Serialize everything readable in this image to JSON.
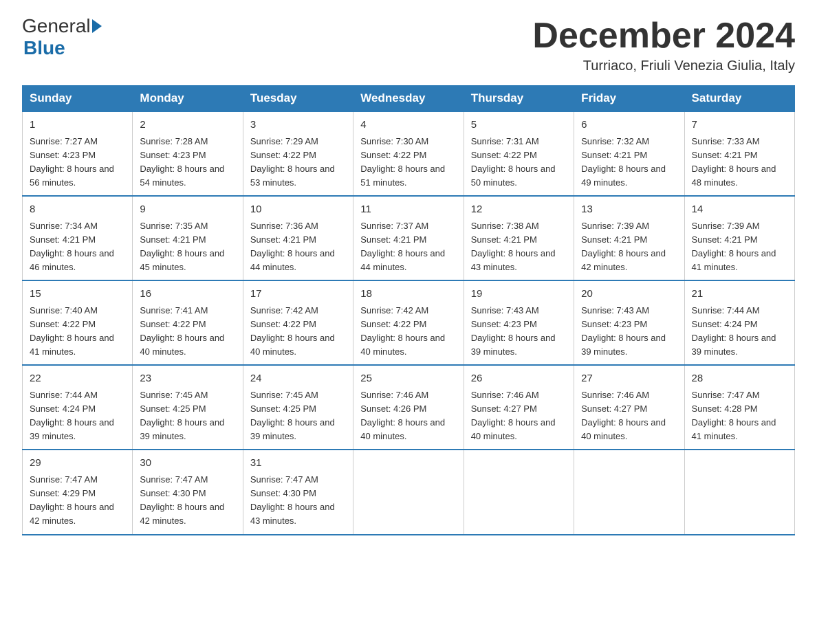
{
  "logo": {
    "general": "General",
    "blue": "Blue"
  },
  "header": {
    "title": "December 2024",
    "location": "Turriaco, Friuli Venezia Giulia, Italy"
  },
  "weekdays": [
    "Sunday",
    "Monday",
    "Tuesday",
    "Wednesday",
    "Thursday",
    "Friday",
    "Saturday"
  ],
  "weeks": [
    [
      {
        "day": "1",
        "sunrise": "7:27 AM",
        "sunset": "4:23 PM",
        "daylight": "8 hours and 56 minutes."
      },
      {
        "day": "2",
        "sunrise": "7:28 AM",
        "sunset": "4:23 PM",
        "daylight": "8 hours and 54 minutes."
      },
      {
        "day": "3",
        "sunrise": "7:29 AM",
        "sunset": "4:22 PM",
        "daylight": "8 hours and 53 minutes."
      },
      {
        "day": "4",
        "sunrise": "7:30 AM",
        "sunset": "4:22 PM",
        "daylight": "8 hours and 51 minutes."
      },
      {
        "day": "5",
        "sunrise": "7:31 AM",
        "sunset": "4:22 PM",
        "daylight": "8 hours and 50 minutes."
      },
      {
        "day": "6",
        "sunrise": "7:32 AM",
        "sunset": "4:21 PM",
        "daylight": "8 hours and 49 minutes."
      },
      {
        "day": "7",
        "sunrise": "7:33 AM",
        "sunset": "4:21 PM",
        "daylight": "8 hours and 48 minutes."
      }
    ],
    [
      {
        "day": "8",
        "sunrise": "7:34 AM",
        "sunset": "4:21 PM",
        "daylight": "8 hours and 46 minutes."
      },
      {
        "day": "9",
        "sunrise": "7:35 AM",
        "sunset": "4:21 PM",
        "daylight": "8 hours and 45 minutes."
      },
      {
        "day": "10",
        "sunrise": "7:36 AM",
        "sunset": "4:21 PM",
        "daylight": "8 hours and 44 minutes."
      },
      {
        "day": "11",
        "sunrise": "7:37 AM",
        "sunset": "4:21 PM",
        "daylight": "8 hours and 44 minutes."
      },
      {
        "day": "12",
        "sunrise": "7:38 AM",
        "sunset": "4:21 PM",
        "daylight": "8 hours and 43 minutes."
      },
      {
        "day": "13",
        "sunrise": "7:39 AM",
        "sunset": "4:21 PM",
        "daylight": "8 hours and 42 minutes."
      },
      {
        "day": "14",
        "sunrise": "7:39 AM",
        "sunset": "4:21 PM",
        "daylight": "8 hours and 41 minutes."
      }
    ],
    [
      {
        "day": "15",
        "sunrise": "7:40 AM",
        "sunset": "4:22 PM",
        "daylight": "8 hours and 41 minutes."
      },
      {
        "day": "16",
        "sunrise": "7:41 AM",
        "sunset": "4:22 PM",
        "daylight": "8 hours and 40 minutes."
      },
      {
        "day": "17",
        "sunrise": "7:42 AM",
        "sunset": "4:22 PM",
        "daylight": "8 hours and 40 minutes."
      },
      {
        "day": "18",
        "sunrise": "7:42 AM",
        "sunset": "4:22 PM",
        "daylight": "8 hours and 40 minutes."
      },
      {
        "day": "19",
        "sunrise": "7:43 AM",
        "sunset": "4:23 PM",
        "daylight": "8 hours and 39 minutes."
      },
      {
        "day": "20",
        "sunrise": "7:43 AM",
        "sunset": "4:23 PM",
        "daylight": "8 hours and 39 minutes."
      },
      {
        "day": "21",
        "sunrise": "7:44 AM",
        "sunset": "4:24 PM",
        "daylight": "8 hours and 39 minutes."
      }
    ],
    [
      {
        "day": "22",
        "sunrise": "7:44 AM",
        "sunset": "4:24 PM",
        "daylight": "8 hours and 39 minutes."
      },
      {
        "day": "23",
        "sunrise": "7:45 AM",
        "sunset": "4:25 PM",
        "daylight": "8 hours and 39 minutes."
      },
      {
        "day": "24",
        "sunrise": "7:45 AM",
        "sunset": "4:25 PM",
        "daylight": "8 hours and 39 minutes."
      },
      {
        "day": "25",
        "sunrise": "7:46 AM",
        "sunset": "4:26 PM",
        "daylight": "8 hours and 40 minutes."
      },
      {
        "day": "26",
        "sunrise": "7:46 AM",
        "sunset": "4:27 PM",
        "daylight": "8 hours and 40 minutes."
      },
      {
        "day": "27",
        "sunrise": "7:46 AM",
        "sunset": "4:27 PM",
        "daylight": "8 hours and 40 minutes."
      },
      {
        "day": "28",
        "sunrise": "7:47 AM",
        "sunset": "4:28 PM",
        "daylight": "8 hours and 41 minutes."
      }
    ],
    [
      {
        "day": "29",
        "sunrise": "7:47 AM",
        "sunset": "4:29 PM",
        "daylight": "8 hours and 42 minutes."
      },
      {
        "day": "30",
        "sunrise": "7:47 AM",
        "sunset": "4:30 PM",
        "daylight": "8 hours and 42 minutes."
      },
      {
        "day": "31",
        "sunrise": "7:47 AM",
        "sunset": "4:30 PM",
        "daylight": "8 hours and 43 minutes."
      },
      null,
      null,
      null,
      null
    ]
  ]
}
